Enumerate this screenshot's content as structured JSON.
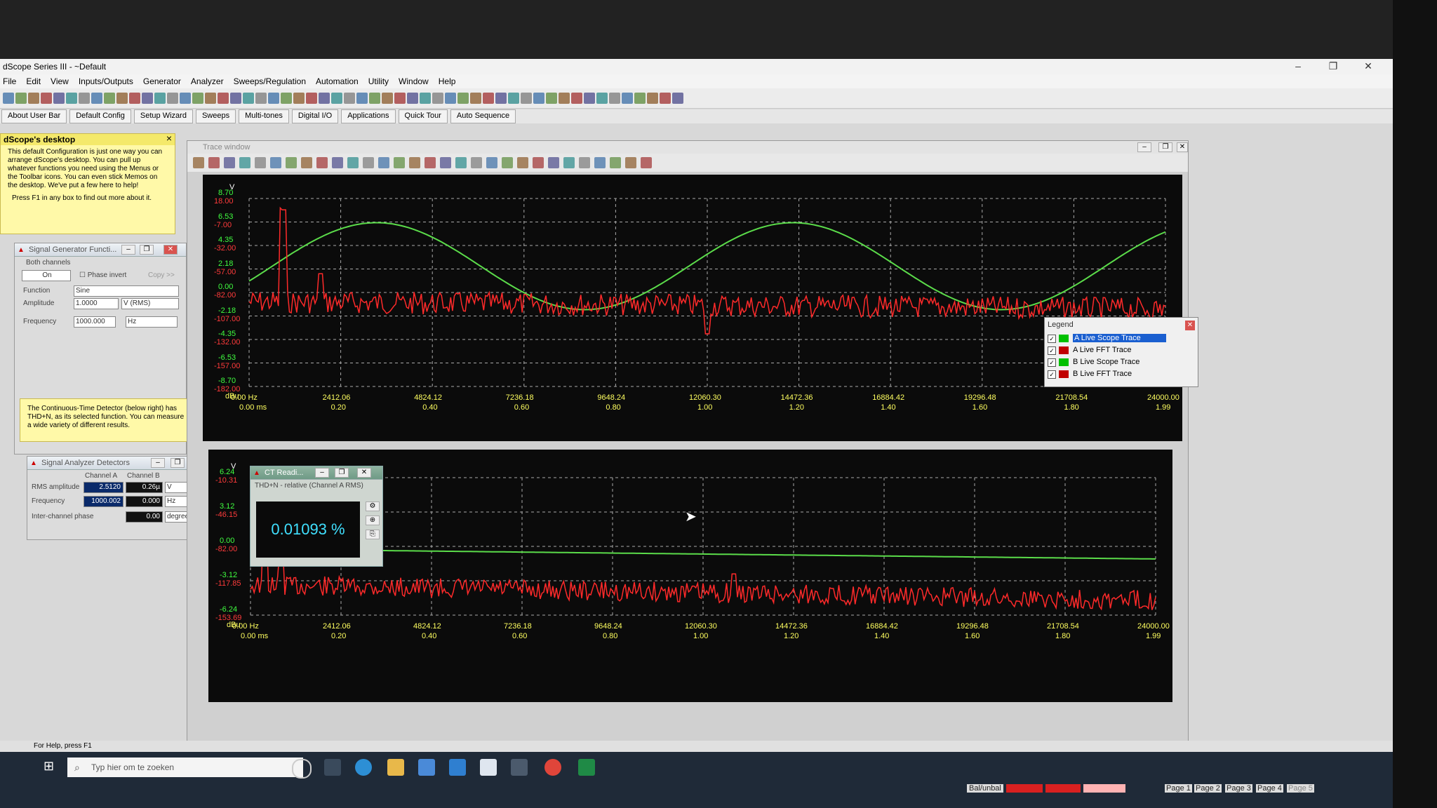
{
  "app": {
    "title": "dScope Series III - ~Default",
    "window_controls": [
      "–",
      "❐",
      "✕"
    ]
  },
  "menu": [
    "File",
    "Edit",
    "View",
    "Inputs/Outputs",
    "Generator",
    "Analyzer",
    "Sweeps/Regulation",
    "Automation",
    "Utility",
    "Window",
    "Help"
  ],
  "quickbar": [
    "About User Bar",
    "Default Config",
    "Setup Wizard",
    "Sweeps",
    "Multi-tones",
    "Digital I/O",
    "Applications",
    "Quick Tour",
    "Auto Sequence"
  ],
  "memo1": {
    "title": "dScope's desktop",
    "body": "This default Configuration is just one way you can arrange dScope's desktop. You can pull up whatever functions you need using the Menus or the Toolbar icons. You can even stick Memos on the desktop. We've put a few here to help!",
    "footer": "Press F1 in any box to find out more about it."
  },
  "memo2": {
    "body": "The Continuous-Time Detector (below right) has THD+N, as its selected function. You can measure a wide variety of different results."
  },
  "siggen": {
    "title": "Signal Generator Functi...",
    "group": "Both channels",
    "on_label": "On",
    "phase_invert": "Phase invert",
    "copy": "Copy >>",
    "function_label": "Function",
    "function_value": "Sine",
    "amplitude_label": "Amplitude",
    "amplitude_value": "1.0000",
    "amplitude_unit": "V (RMS)",
    "frequency_label": "Frequency",
    "frequency_value": "1000.000",
    "frequency_unit": "Hz"
  },
  "analyzer": {
    "title": "Signal Analyzer Detectors",
    "col_a": "Channel A",
    "col_b": "Channel B",
    "rows": [
      {
        "label": "RMS amplitude",
        "a": "2.5120",
        "b": "0.26µ",
        "unit": "V"
      },
      {
        "label": "Frequency",
        "a": "1000.002",
        "b": "0.000",
        "unit": "Hz"
      },
      {
        "label": "Inter-channel phase",
        "a": "",
        "b": "0.00",
        "unit": "degrees"
      }
    ]
  },
  "ct_reading": {
    "title": "CT Readi...",
    "subtitle": "THD+N - relative (Channel A RMS)",
    "value": "0.01093 %"
  },
  "trace_window": {
    "title": "Trace window"
  },
  "legend": {
    "title": "Legend",
    "items": [
      {
        "name": "A Live Scope Trace",
        "color": "#00c000",
        "selected": true
      },
      {
        "name": "A Live FFT Trace",
        "color": "#c00000",
        "selected": false
      },
      {
        "name": "B Live Scope Trace",
        "color": "#00c000",
        "selected": false
      },
      {
        "name": "B Live FFT Trace",
        "color": "#c00000",
        "selected": false
      }
    ]
  },
  "graph1": {
    "y_unit_top": "V",
    "y_unit_bottom": "dBu",
    "y_ticks": [
      {
        "green": "8.70",
        "red": "18.00"
      },
      {
        "green": "6.53",
        "red": "-7.00"
      },
      {
        "green": "4.35",
        "red": "-32.00"
      },
      {
        "green": "2.18",
        "red": "-57.00"
      },
      {
        "green": "0.00",
        "red": "-82.00"
      },
      {
        "green": "-2.18",
        "red": "-107.00"
      },
      {
        "green": "-4.35",
        "red": "-132.00"
      },
      {
        "green": "-6.53",
        "red": "-157.00"
      },
      {
        "green": "-8.70",
        "red": "-182.00"
      }
    ],
    "x_ticks": [
      {
        "top": "0.00 Hz",
        "bottom": "0.00 ms"
      },
      {
        "top": "2412.06",
        "bottom": "0.20"
      },
      {
        "top": "4824.12",
        "bottom": "0.40"
      },
      {
        "top": "7236.18",
        "bottom": "0.60"
      },
      {
        "top": "9648.24",
        "bottom": "0.80"
      },
      {
        "top": "12060.30",
        "bottom": "1.00"
      },
      {
        "top": "14472.36",
        "bottom": "1.20"
      },
      {
        "top": "16884.42",
        "bottom": "1.40"
      },
      {
        "top": "19296.48",
        "bottom": "1.60"
      },
      {
        "top": "21708.54",
        "bottom": "1.80"
      },
      {
        "top": "24000.00",
        "bottom": "1.99"
      }
    ]
  },
  "graph2": {
    "y_unit_top": "V",
    "y_unit_bottom": "dBu",
    "y_ticks": [
      {
        "green": "6.24",
        "red": "-10.31"
      },
      {
        "green": "3.12",
        "red": "-46.15"
      },
      {
        "green": "0.00",
        "red": "-82.00"
      },
      {
        "green": "-3.12",
        "red": "-117.85"
      },
      {
        "green": "-6.24",
        "red": "-153.69"
      }
    ],
    "x_ticks": [
      {
        "top": "0.00 Hz",
        "bottom": "0.00 ms"
      },
      {
        "top": "2412.06",
        "bottom": "0.20"
      },
      {
        "top": "4824.12",
        "bottom": "0.40"
      },
      {
        "top": "7236.18",
        "bottom": "0.60"
      },
      {
        "top": "9648.24",
        "bottom": "0.80"
      },
      {
        "top": "12060.30",
        "bottom": "1.00"
      },
      {
        "top": "14472.36",
        "bottom": "1.20"
      },
      {
        "top": "16884.42",
        "bottom": "1.40"
      },
      {
        "top": "19296.48",
        "bottom": "1.60"
      },
      {
        "top": "21708.54",
        "bottom": "1.80"
      },
      {
        "top": "24000.00",
        "bottom": "1.99"
      }
    ]
  },
  "status": {
    "help": "For Help, press F1",
    "balunbal": "Bal/unbal",
    "pages": [
      "Page 1",
      "Page 2",
      "Page 3",
      "Page 4",
      "Page 5"
    ]
  },
  "taskbar": {
    "search_placeholder": "Typ hier om te zoeken"
  }
}
